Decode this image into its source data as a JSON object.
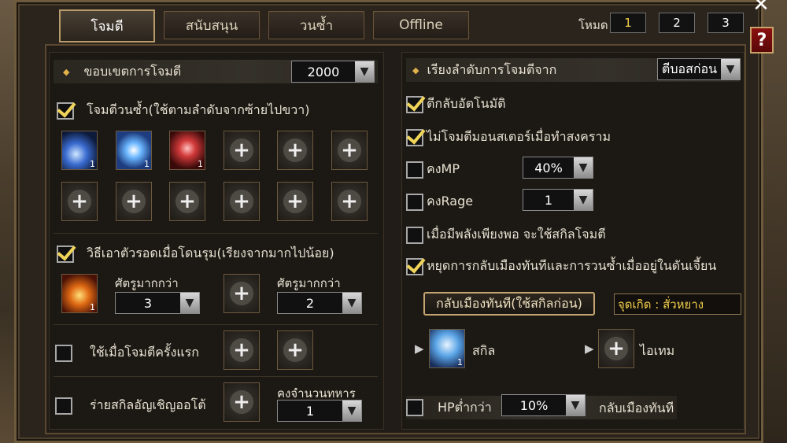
{
  "tabs": [
    "โจมตี",
    "สนับสนุน",
    "วนซ้ำ",
    "Offline"
  ],
  "mode": {
    "label": "โหมด",
    "buttons": [
      "1",
      "2",
      "3"
    ],
    "selected": "1"
  },
  "help_label": "?",
  "left": {
    "attack_range": {
      "label": "ขอบเขตการโจมตี",
      "value": "2000"
    },
    "loop_attack": {
      "label": "โจมตีวนซ้ำ(ใช้ตามลำดับจากซ้ายไปขวา)",
      "checked": true,
      "skill_counts": [
        "1",
        "1",
        "1"
      ]
    },
    "survival": {
      "label": "วิธีเอาตัวรอดเมื่อโดนรุม(เรียงจากมากไปน้อย)",
      "checked": true,
      "skill_count": "1",
      "enemy_more_label_1": "ศัตรูมากกว่า",
      "enemy_more_value_1": "3",
      "enemy_more_label_2": "ศัตรูมากกว่า",
      "enemy_more_value_2": "2"
    },
    "first_attack": {
      "label": "ใช้เมื่อโจมตีครั้งแรก",
      "checked": false
    },
    "summon": {
      "label": "ร่ายสกิลอัญเชิญออโต้",
      "checked": false,
      "keep_label": "คงจำนวนทหาร",
      "keep_value": "1"
    }
  },
  "right": {
    "order": {
      "label": "เรียงลำดับการโจมตีจาก",
      "value": "ตีบอสก่อน"
    },
    "counter": {
      "label": "ตีกลับอัตโนมัติ",
      "checked": true
    },
    "no_monster_war": {
      "label": "ไม่โจมตีมอนสเตอร์เมื่อทำสงคราม",
      "checked": true
    },
    "keep_mp": {
      "label": "คงMP",
      "checked": false,
      "value": "40%"
    },
    "keep_rage": {
      "label": "คงRage",
      "checked": false,
      "value": "1"
    },
    "enough_power": {
      "label": "เมื่อมีพลังเพียงพอ จะใช้สกิลโจมตี",
      "checked": false
    },
    "stop_return": {
      "label": "หยุดการกลับเมืองทันทีและการวนซ้ำเมื่ออยู่ในดันเจี้ยน",
      "checked": true
    },
    "return_skill_label": "กลับเมืองทันที(ใช้สกิลก่อน)",
    "spawn_label": "จุดเกิด : สั่วหยาง",
    "skill_label": "สกิล",
    "skill_count": "1",
    "item_label": "ไอเทม",
    "hp": {
      "label": "HPต่ำกว่า",
      "checked": false,
      "value": "10%",
      "action": "กลับเมืองทันที"
    }
  },
  "colors": {
    "accent": "#f3cf4a",
    "frame": "#6e5a3c",
    "help": "#8a1010"
  }
}
